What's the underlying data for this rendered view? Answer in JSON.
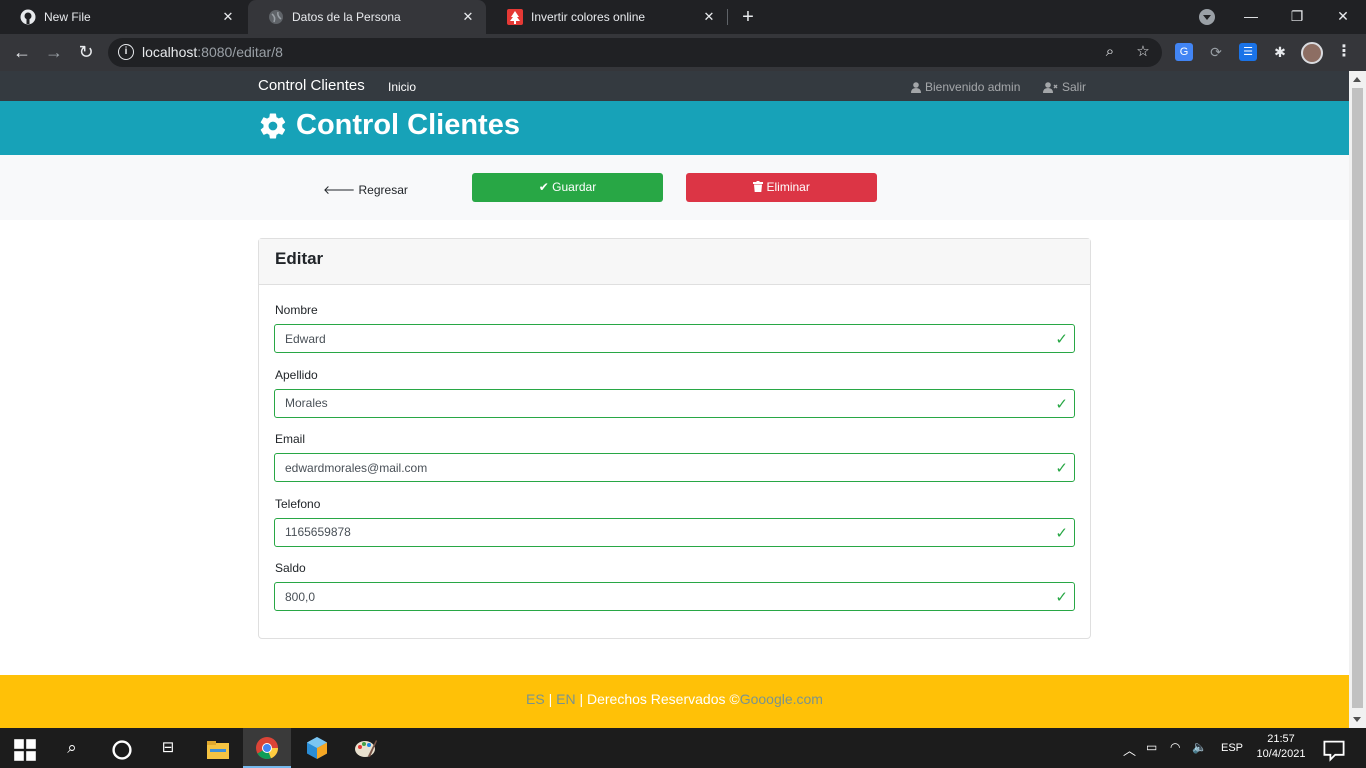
{
  "browser": {
    "tabs": [
      {
        "title": "New File",
        "icon": "github-icon"
      },
      {
        "title": "Datos de la Persona",
        "icon": "globe-icon"
      },
      {
        "title": "Invertir colores online",
        "icon": "tree-icon"
      }
    ],
    "url_host": "localhost",
    "url_path": ":8080/editar/8"
  },
  "navbar": {
    "brand": "Control Clientes",
    "inicio": "Inicio",
    "welcome": "Bienvenido admin",
    "logout": "Salir"
  },
  "header": {
    "title": "Control Clientes"
  },
  "actions": {
    "back": "Regresar",
    "save": "Guardar",
    "delete": "Eliminar"
  },
  "card": {
    "title": "Editar",
    "fields": [
      {
        "label": "Nombre",
        "value": "Edward"
      },
      {
        "label": "Apellido",
        "value": "Morales"
      },
      {
        "label": "Email",
        "value": "edwardmorales@mail.com"
      },
      {
        "label": "Telefono",
        "value": "1165659878"
      },
      {
        "label": "Saldo",
        "value": "800,0"
      }
    ]
  },
  "footer": {
    "es": "ES",
    "sep1": " | ",
    "en": "EN",
    "text": " | Derechos Reservados ©",
    "site": "Gooogle.com"
  },
  "taskbar": {
    "lang": "ESP",
    "time": "21:57",
    "date": "10/4/2021"
  },
  "colors": {
    "navbar": "#343a40",
    "header": "#17a2b8",
    "success": "#28a745",
    "danger": "#dc3545",
    "footer": "#ffc107"
  }
}
